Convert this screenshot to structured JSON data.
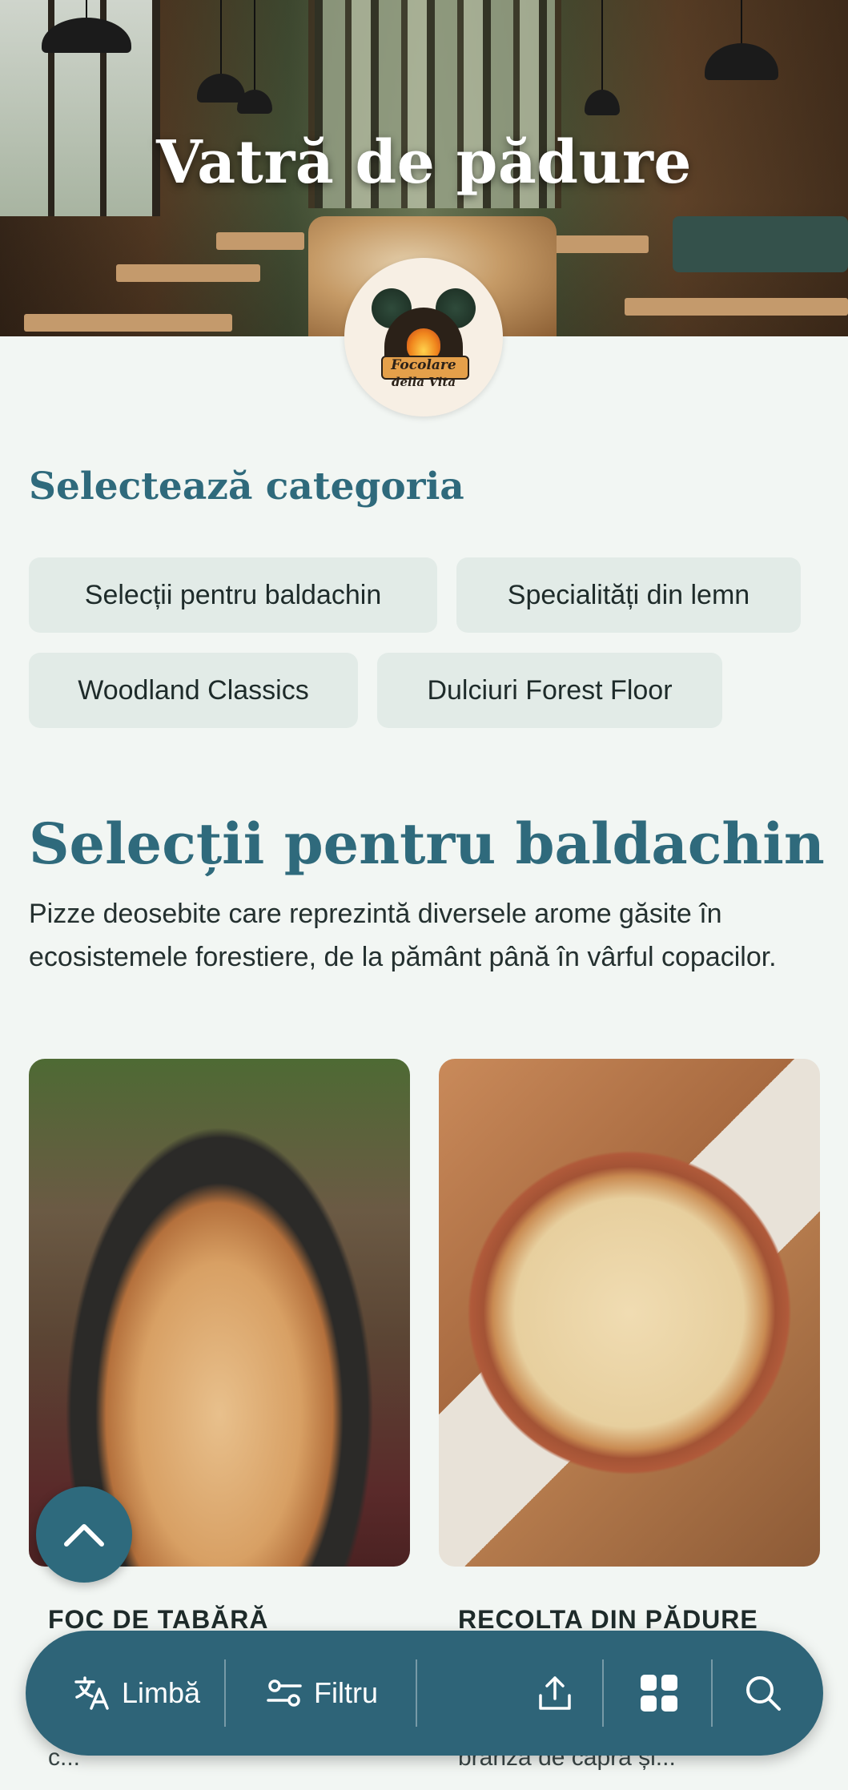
{
  "hero": {
    "title": "Vatră de pădure",
    "logo_text_line1": "Focolare",
    "logo_text_line2": "della Vita"
  },
  "categories": {
    "heading": "Selectează categoria",
    "items": [
      {
        "label": "Selecții pentru baldachin"
      },
      {
        "label": "Specialități din lemn"
      },
      {
        "label": "Woodland Classics"
      },
      {
        "label": "Dulciuri Forest Floor"
      }
    ]
  },
  "section": {
    "title": "Selecții pentru baldachin",
    "description": "Pizze deosebite care reprezintă diversele arome găsite în ecosistemele forestiere, de la pământ până în vârful copacilor."
  },
  "products": [
    {
      "title": "FOC DE TABĂRĂ",
      "subtitle_fragment": "c..."
    },
    {
      "title": "RECOLTA DIN PĂDURE",
      "subtitle_fragment": "brânză de capră și..."
    }
  ],
  "bottom_bar": {
    "language_label": "Limbă",
    "filter_label": "Filtru"
  },
  "colors": {
    "accent": "#2f6a7c",
    "bar": "#2e6478",
    "background": "#f2f6f3",
    "chip": "#e2ebe7"
  },
  "icons": [
    "translate-icon",
    "filter-icon",
    "share-icon",
    "grid-icon",
    "search-icon",
    "chevron-up-icon"
  ]
}
